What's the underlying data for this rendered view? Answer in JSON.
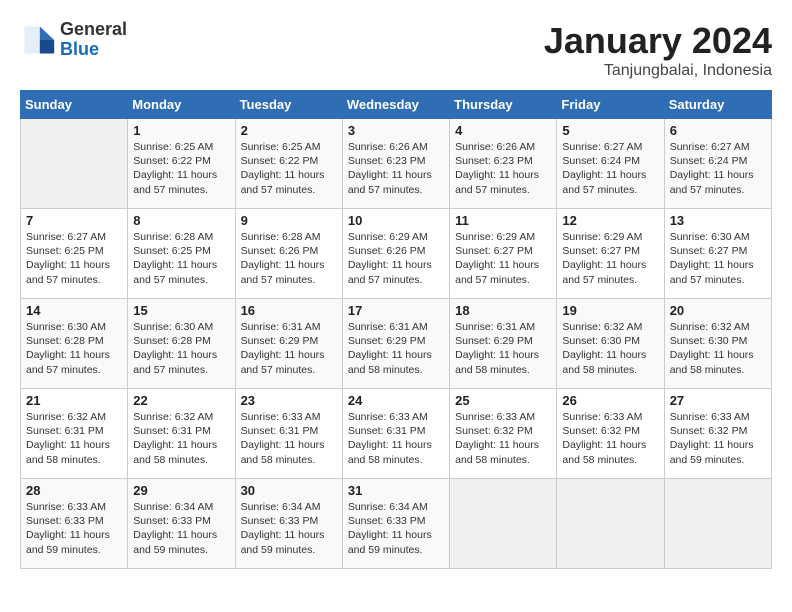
{
  "header": {
    "logo_general": "General",
    "logo_blue": "Blue",
    "month_title": "January 2024",
    "location": "Tanjungbalai, Indonesia"
  },
  "weekdays": [
    "Sunday",
    "Monday",
    "Tuesday",
    "Wednesday",
    "Thursday",
    "Friday",
    "Saturday"
  ],
  "weeks": [
    [
      {
        "day": "",
        "sunrise": "",
        "sunset": "",
        "daylight": ""
      },
      {
        "day": "1",
        "sunrise": "Sunrise: 6:25 AM",
        "sunset": "Sunset: 6:22 PM",
        "daylight": "Daylight: 11 hours and 57 minutes."
      },
      {
        "day": "2",
        "sunrise": "Sunrise: 6:25 AM",
        "sunset": "Sunset: 6:22 PM",
        "daylight": "Daylight: 11 hours and 57 minutes."
      },
      {
        "day": "3",
        "sunrise": "Sunrise: 6:26 AM",
        "sunset": "Sunset: 6:23 PM",
        "daylight": "Daylight: 11 hours and 57 minutes."
      },
      {
        "day": "4",
        "sunrise": "Sunrise: 6:26 AM",
        "sunset": "Sunset: 6:23 PM",
        "daylight": "Daylight: 11 hours and 57 minutes."
      },
      {
        "day": "5",
        "sunrise": "Sunrise: 6:27 AM",
        "sunset": "Sunset: 6:24 PM",
        "daylight": "Daylight: 11 hours and 57 minutes."
      },
      {
        "day": "6",
        "sunrise": "Sunrise: 6:27 AM",
        "sunset": "Sunset: 6:24 PM",
        "daylight": "Daylight: 11 hours and 57 minutes."
      }
    ],
    [
      {
        "day": "7",
        "sunrise": "Sunrise: 6:27 AM",
        "sunset": "Sunset: 6:25 PM",
        "daylight": "Daylight: 11 hours and 57 minutes."
      },
      {
        "day": "8",
        "sunrise": "Sunrise: 6:28 AM",
        "sunset": "Sunset: 6:25 PM",
        "daylight": "Daylight: 11 hours and 57 minutes."
      },
      {
        "day": "9",
        "sunrise": "Sunrise: 6:28 AM",
        "sunset": "Sunset: 6:26 PM",
        "daylight": "Daylight: 11 hours and 57 minutes."
      },
      {
        "day": "10",
        "sunrise": "Sunrise: 6:29 AM",
        "sunset": "Sunset: 6:26 PM",
        "daylight": "Daylight: 11 hours and 57 minutes."
      },
      {
        "day": "11",
        "sunrise": "Sunrise: 6:29 AM",
        "sunset": "Sunset: 6:27 PM",
        "daylight": "Daylight: 11 hours and 57 minutes."
      },
      {
        "day": "12",
        "sunrise": "Sunrise: 6:29 AM",
        "sunset": "Sunset: 6:27 PM",
        "daylight": "Daylight: 11 hours and 57 minutes."
      },
      {
        "day": "13",
        "sunrise": "Sunrise: 6:30 AM",
        "sunset": "Sunset: 6:27 PM",
        "daylight": "Daylight: 11 hours and 57 minutes."
      }
    ],
    [
      {
        "day": "14",
        "sunrise": "Sunrise: 6:30 AM",
        "sunset": "Sunset: 6:28 PM",
        "daylight": "Daylight: 11 hours and 57 minutes."
      },
      {
        "day": "15",
        "sunrise": "Sunrise: 6:30 AM",
        "sunset": "Sunset: 6:28 PM",
        "daylight": "Daylight: 11 hours and 57 minutes."
      },
      {
        "day": "16",
        "sunrise": "Sunrise: 6:31 AM",
        "sunset": "Sunset: 6:29 PM",
        "daylight": "Daylight: 11 hours and 57 minutes."
      },
      {
        "day": "17",
        "sunrise": "Sunrise: 6:31 AM",
        "sunset": "Sunset: 6:29 PM",
        "daylight": "Daylight: 11 hours and 58 minutes."
      },
      {
        "day": "18",
        "sunrise": "Sunrise: 6:31 AM",
        "sunset": "Sunset: 6:29 PM",
        "daylight": "Daylight: 11 hours and 58 minutes."
      },
      {
        "day": "19",
        "sunrise": "Sunrise: 6:32 AM",
        "sunset": "Sunset: 6:30 PM",
        "daylight": "Daylight: 11 hours and 58 minutes."
      },
      {
        "day": "20",
        "sunrise": "Sunrise: 6:32 AM",
        "sunset": "Sunset: 6:30 PM",
        "daylight": "Daylight: 11 hours and 58 minutes."
      }
    ],
    [
      {
        "day": "21",
        "sunrise": "Sunrise: 6:32 AM",
        "sunset": "Sunset: 6:31 PM",
        "daylight": "Daylight: 11 hours and 58 minutes."
      },
      {
        "day": "22",
        "sunrise": "Sunrise: 6:32 AM",
        "sunset": "Sunset: 6:31 PM",
        "daylight": "Daylight: 11 hours and 58 minutes."
      },
      {
        "day": "23",
        "sunrise": "Sunrise: 6:33 AM",
        "sunset": "Sunset: 6:31 PM",
        "daylight": "Daylight: 11 hours and 58 minutes."
      },
      {
        "day": "24",
        "sunrise": "Sunrise: 6:33 AM",
        "sunset": "Sunset: 6:31 PM",
        "daylight": "Daylight: 11 hours and 58 minutes."
      },
      {
        "day": "25",
        "sunrise": "Sunrise: 6:33 AM",
        "sunset": "Sunset: 6:32 PM",
        "daylight": "Daylight: 11 hours and 58 minutes."
      },
      {
        "day": "26",
        "sunrise": "Sunrise: 6:33 AM",
        "sunset": "Sunset: 6:32 PM",
        "daylight": "Daylight: 11 hours and 58 minutes."
      },
      {
        "day": "27",
        "sunrise": "Sunrise: 6:33 AM",
        "sunset": "Sunset: 6:32 PM",
        "daylight": "Daylight: 11 hours and 59 minutes."
      }
    ],
    [
      {
        "day": "28",
        "sunrise": "Sunrise: 6:33 AM",
        "sunset": "Sunset: 6:33 PM",
        "daylight": "Daylight: 11 hours and 59 minutes."
      },
      {
        "day": "29",
        "sunrise": "Sunrise: 6:34 AM",
        "sunset": "Sunset: 6:33 PM",
        "daylight": "Daylight: 11 hours and 59 minutes."
      },
      {
        "day": "30",
        "sunrise": "Sunrise: 6:34 AM",
        "sunset": "Sunset: 6:33 PM",
        "daylight": "Daylight: 11 hours and 59 minutes."
      },
      {
        "day": "31",
        "sunrise": "Sunrise: 6:34 AM",
        "sunset": "Sunset: 6:33 PM",
        "daylight": "Daylight: 11 hours and 59 minutes."
      },
      {
        "day": "",
        "sunrise": "",
        "sunset": "",
        "daylight": ""
      },
      {
        "day": "",
        "sunrise": "",
        "sunset": "",
        "daylight": ""
      },
      {
        "day": "",
        "sunrise": "",
        "sunset": "",
        "daylight": ""
      }
    ]
  ]
}
